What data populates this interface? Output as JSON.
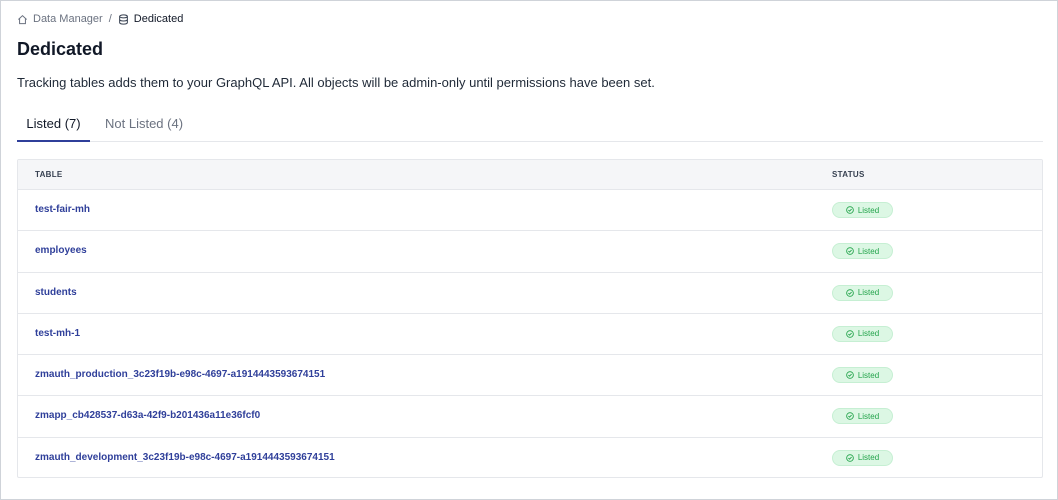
{
  "breadcrumb": {
    "home_label": "Data Manager",
    "separator": "/",
    "current_label": "Dedicated"
  },
  "page": {
    "title": "Dedicated",
    "description": "Tracking tables adds them to your GraphQL API. All objects will be admin-only until permissions have been set."
  },
  "tabs": [
    {
      "label": "Listed (7)",
      "active": true
    },
    {
      "label": "Not Listed (4)",
      "active": false
    }
  ],
  "table": {
    "headers": {
      "table": "TABLE",
      "status": "STATUS"
    },
    "rows": [
      {
        "name": "test-fair-mh",
        "status": "Listed"
      },
      {
        "name": "employees",
        "status": "Listed"
      },
      {
        "name": "students",
        "status": "Listed"
      },
      {
        "name": "test-mh-1",
        "status": "Listed"
      },
      {
        "name": "zmauth_production_3c23f19b-e98c-4697-a1914443593674151",
        "status": "Listed"
      },
      {
        "name": "zmapp_cb428537-d63a-42f9-b201436a11e36fcf0",
        "status": "Listed"
      },
      {
        "name": "zmauth_development_3c23f19b-e98c-4697-a1914443593674151",
        "status": "Listed"
      }
    ]
  },
  "icons": {
    "home": "home-icon",
    "database": "database-icon",
    "status": "check-circle-icon"
  },
  "colors": {
    "accent": "#2f3f9a",
    "status_text": "#22a34a",
    "status_bg": "#dcf7e4"
  }
}
